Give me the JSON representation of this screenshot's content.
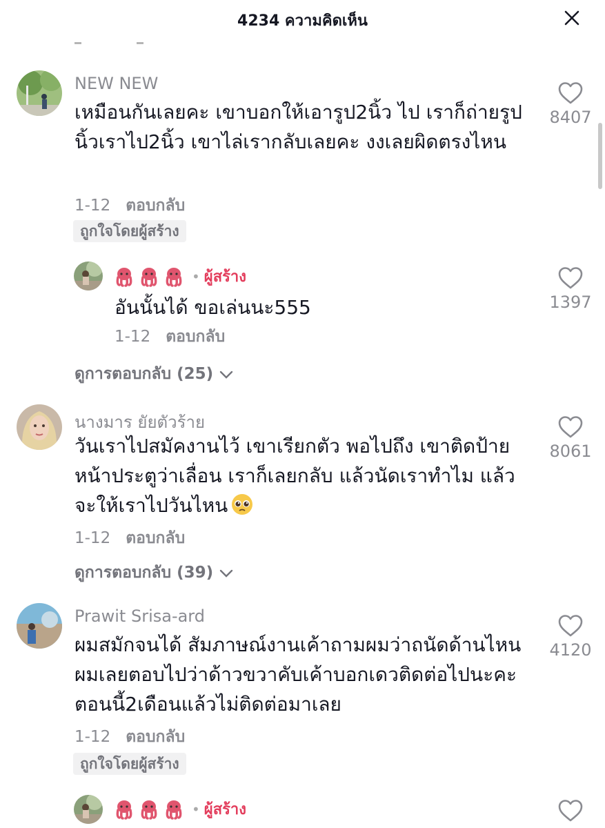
{
  "header": {
    "title": "4234 ความคิดเห็น"
  },
  "comments": [
    {
      "username": "NEW NEW",
      "text": "เหมือนกันเลยคะ เขาบอกให้เอารูป2นิ้ว ไป เราก็ถ่ายรูปนิ้วเราไป2นิ้ว เขาไล่เรากลับเลยคะ งงเลยผิดตรงไหน",
      "date": "1-12",
      "reply_label": "ตอบกลับ",
      "likes": "8407",
      "badge": "ถูกใจโดยผู้สร้าง",
      "creator_reply": {
        "creator_label": "ผู้สร้าง",
        "text": "อันนั้นได้ ขอเล่นนะ555",
        "date": "1-12",
        "reply_label": "ตอบกลับ",
        "likes": "1397"
      },
      "view_replies": "ดูการตอบกลับ (25)"
    },
    {
      "username": "นางมาร ยัยตัวร้าย",
      "text": "วันเราไปสมัคงานไว้ เขาเรียกตัว พอไปถึง เขาติดป้ายหน้าประตูว่าเลื่อน เราก็เลยกลับ แล้วนัดเราทำไม แล้วจะให้เราไปวันไหน",
      "date": "1-12",
      "reply_label": "ตอบกลับ",
      "likes": "8061",
      "view_replies": "ดูการตอบกลับ (39)"
    },
    {
      "username": "Prawit Srisa-ard",
      "text": "ผมสมักจนได้ สัมภาษณ์งานเค้าถามผมว่าถนัดด้านไหนผมเลยตอบไปว่าด้าวขวาคับเค้าบอกเดวติดต่อไปนะคะตอนนี้2เดือนแล้วไม่ติดต่อมาเลย",
      "date": "1-12",
      "reply_label": "ตอบกลับ",
      "likes": "4120",
      "badge": "ถูกใจโดยผู้สร้าง",
      "creator_reply": {
        "creator_label": "ผู้สร้าง"
      }
    }
  ],
  "icons": {
    "close": "close-icon",
    "like": "heart-outline-icon",
    "chevron": "chevron-down-icon",
    "creator_avatar": "octopus-emoji-icon",
    "pleading_emoji": "pleading-face-emoji"
  },
  "colors": {
    "text": "#161823",
    "secondary": "#8a8b91",
    "creator": "#e33d5c",
    "badge_bg": "#f1f1f2"
  }
}
